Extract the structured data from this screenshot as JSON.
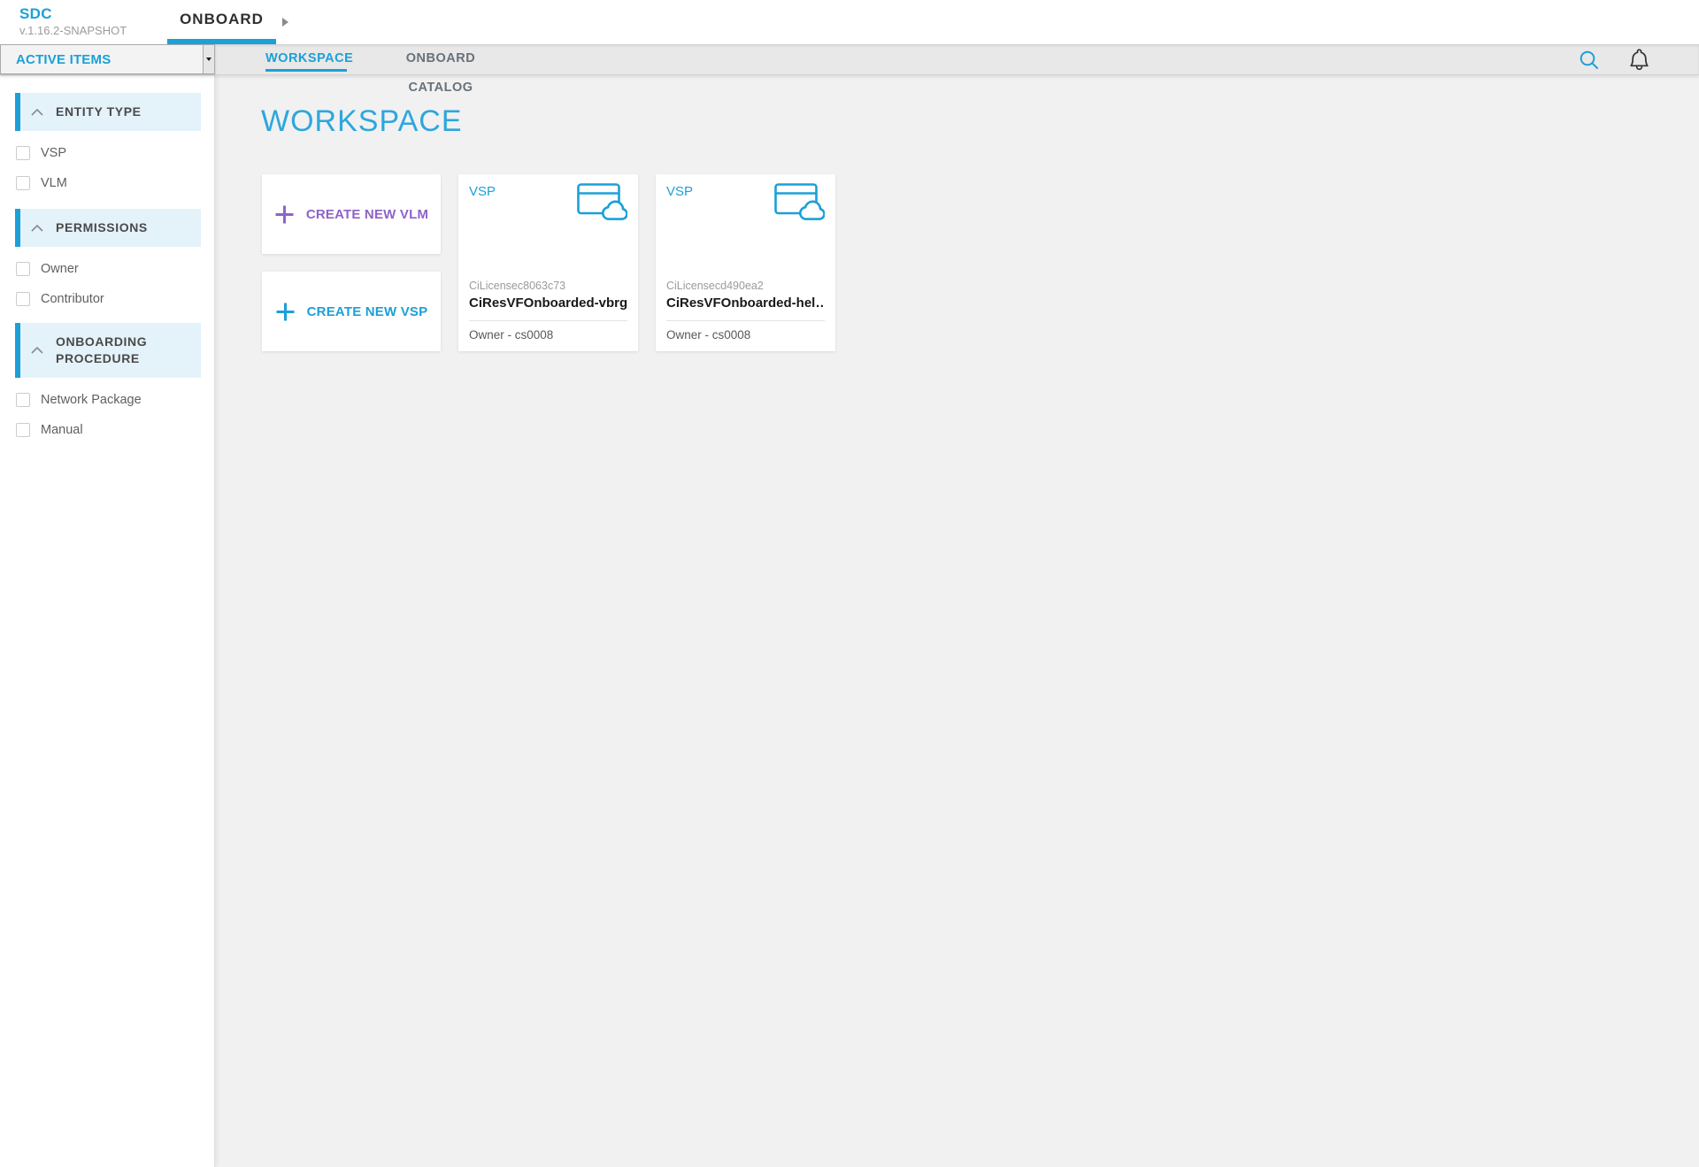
{
  "header": {
    "logo_title": "SDC",
    "logo_version": "v.1.16.2-SNAPSHOT",
    "nav_tab": "ONBOARD"
  },
  "toolbar": {
    "filter_select_value": "ACTIVE ITEMS",
    "tabs": [
      {
        "label": "WORKSPACE",
        "active": true
      },
      {
        "label": "ONBOARD CATALOG",
        "active": false
      }
    ],
    "icons": [
      "search-icon",
      "notifications-bell-icon"
    ]
  },
  "sidebar": {
    "sections": [
      {
        "title": "ENTITY TYPE",
        "icon": "chevron-up-icon",
        "items": [
          {
            "label": "VSP",
            "checked": false
          },
          {
            "label": "VLM",
            "checked": false
          }
        ]
      },
      {
        "title": "PERMISSIONS",
        "icon": "chevron-up-icon",
        "items": [
          {
            "label": "Owner",
            "checked": false
          },
          {
            "label": "Contributor",
            "checked": false
          }
        ]
      },
      {
        "title": "ONBOARDING PROCEDURE",
        "icon": "chevron-up-icon",
        "items": [
          {
            "label": "Network Package",
            "checked": false
          },
          {
            "label": "Manual",
            "checked": false
          }
        ]
      }
    ]
  },
  "main": {
    "title": "WORKSPACE",
    "create_buttons": [
      {
        "label": "CREATE NEW VLM",
        "icon": "plus-icon",
        "color": "#8f63c9"
      },
      {
        "label": "CREATE NEW VSP",
        "icon": "plus-icon",
        "color": "#1ba0d8"
      }
    ],
    "cards": [
      {
        "type": "VSP",
        "icon": "browser-cloud-icon",
        "vendor": "CiLicensec8063c73",
        "name": "CiResVFOnboarded-vbrg…",
        "owner": "Owner - cs0008"
      },
      {
        "type": "VSP",
        "icon": "browser-cloud-icon",
        "vendor": "CiLicensecd490ea2",
        "name": "CiResVFOnboarded-hel…",
        "owner": "Owner - cs0008"
      }
    ]
  },
  "colors": {
    "accent_blue": "#1ba0d8",
    "purple": "#8f63c9",
    "section_header_bg": "#e4f2fa",
    "toolbar_bg": "#e8e8e8",
    "main_bg": "#f1f1f1"
  }
}
